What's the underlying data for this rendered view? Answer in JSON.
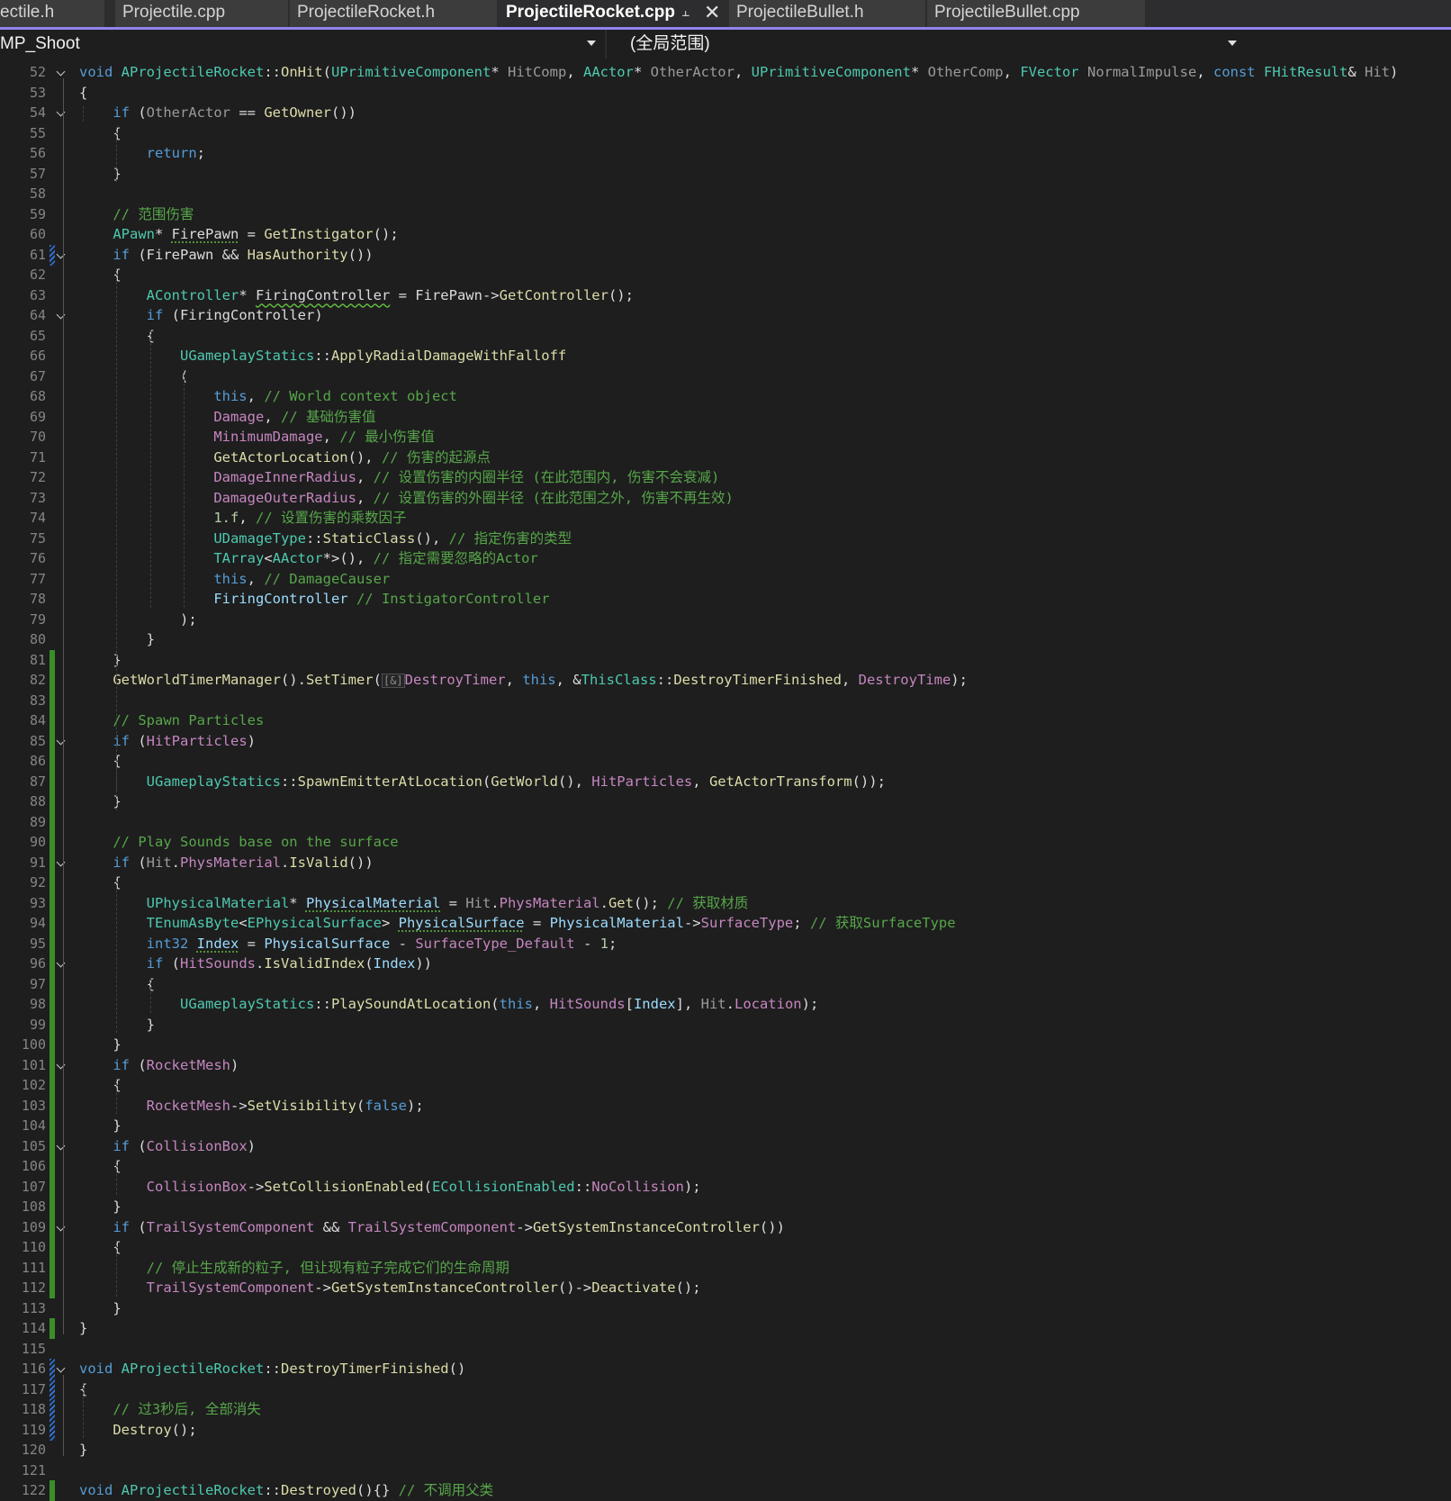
{
  "tabs": [
    {
      "label": "ectile.h",
      "active": false
    },
    {
      "label": "Projectile.cpp",
      "active": false
    },
    {
      "label": "ProjectileRocket.h",
      "active": false
    },
    {
      "label": "ProjectileRocket.cpp",
      "active": true,
      "pin_icon": "pin-icon",
      "close_icon": "close-icon"
    },
    {
      "label": "ProjectileBullet.h",
      "active": false
    },
    {
      "label": "ProjectileBullet.cpp",
      "active": false
    }
  ],
  "nav": {
    "project": "MP_Shoot",
    "scope": "(全局范围)"
  },
  "colors": {
    "accent": "#9184ee",
    "keyword": "#569cd6",
    "type": "#4ec9b0",
    "function": "#dcdcaa",
    "comment": "#57a64a",
    "member": "#c586c0",
    "change_saved": "#3a8e2a",
    "change_unsaved": "#2f6fd1"
  },
  "code": {
    "lines": [
      {
        "n": "52",
        "bar": "",
        "fold": true,
        "html": "<span class='k'>void</span> <span class='t'>AProjectileRocket</span>::<span class='f'>OnHit</span>(<span class='t'>UPrimitiveComponent</span>* <span class='v'>HitComp</span>, <span class='t'>AActor</span>* <span class='v'>OtherActor</span>, <span class='t'>UPrimitiveComponent</span>* <span class='v'>OtherComp</span>, <span class='t'>FVector</span> <span class='v'>NormalImpulse</span>, <span class='k'>const</span> <span class='t'>FHitResult</span>&amp; <span class='v'>Hit</span>)"
      },
      {
        "n": "53",
        "bar": "",
        "fold": false,
        "html": "{"
      },
      {
        "n": "54",
        "bar": "",
        "fold": true,
        "html": "    <span class='k'>if</span> (<span class='v'>OtherActor</span> == <span class='f'>GetOwner</span>())"
      },
      {
        "n": "55",
        "bar": "",
        "fold": false,
        "html": "    {"
      },
      {
        "n": "56",
        "bar": "",
        "fold": false,
        "html": "        <span class='k'>return</span>;"
      },
      {
        "n": "57",
        "bar": "",
        "fold": false,
        "html": "    }"
      },
      {
        "n": "58",
        "bar": "",
        "fold": false,
        "html": ""
      },
      {
        "n": "59",
        "bar": "",
        "fold": false,
        "html": "    <span class='c'>// 范围伤害</span>"
      },
      {
        "n": "60",
        "bar": "",
        "fold": false,
        "html": "    <span class='t'>APawn</span>* <span class='dots'>FirePawn</span> = <span class='f'>GetInstigator</span>();"
      },
      {
        "n": "61",
        "bar": "unsaved",
        "fold": true,
        "html": "    <span class='k'>if</span> (<span class='v2'>FirePawn</span> &amp;&amp; <span class='f'>HasAuthority</span>())"
      },
      {
        "n": "62",
        "bar": "",
        "fold": false,
        "html": "    {"
      },
      {
        "n": "63",
        "bar": "",
        "fold": false,
        "html": "        <span class='t'>AController</span>* <span class='squig'>FiringController</span> = <span class='v2'>FirePawn</span>-><span class='f'>GetController</span>();"
      },
      {
        "n": "64",
        "bar": "",
        "fold": true,
        "html": "        <span class='k'>if</span> (<span class='v2'>FiringController</span>)"
      },
      {
        "n": "65",
        "bar": "",
        "fold": false,
        "html": "        {"
      },
      {
        "n": "66",
        "bar": "",
        "fold": false,
        "html": "            <span class='t'>UGameplayStatics</span>::<span class='f'>ApplyRadialDamageWithFalloff</span>"
      },
      {
        "n": "67",
        "bar": "",
        "fold": false,
        "html": "            ("
      },
      {
        "n": "68",
        "bar": "",
        "fold": false,
        "html": "                <span class='k'>this</span>, <span class='c'>// World context object</span>"
      },
      {
        "n": "69",
        "bar": "",
        "fold": false,
        "html": "                <span class='m'>Damage</span>, <span class='c'>// 基础伤害值</span>"
      },
      {
        "n": "70",
        "bar": "",
        "fold": false,
        "html": "                <span class='m'>MinimumDamage</span>, <span class='c'>// 最小伤害值</span>"
      },
      {
        "n": "71",
        "bar": "",
        "fold": false,
        "html": "                <span class='f'>GetActorLocation</span>(), <span class='c'>// 伤害的起源点</span>"
      },
      {
        "n": "72",
        "bar": "",
        "fold": false,
        "html": "                <span class='m'>DamageInnerRadius</span>, <span class='c'>// 设置伤害的内圈半径 (在此范围内, 伤害不会衰减)</span>"
      },
      {
        "n": "73",
        "bar": "",
        "fold": false,
        "html": "                <span class='m'>DamageOuterRadius</span>, <span class='c'>// 设置伤害的外圈半径 (在此范围之外, 伤害不再生效)</span>"
      },
      {
        "n": "74",
        "bar": "",
        "fold": false,
        "html": "                <span class='n'>1.f</span>, <span class='c'>// 设置伤害的乘数因子</span>"
      },
      {
        "n": "75",
        "bar": "",
        "fold": false,
        "html": "                <span class='t'>UDamageType</span>::<span class='f'>StaticClass</span>(), <span class='c'>// 指定伤害的类型</span>"
      },
      {
        "n": "76",
        "bar": "",
        "fold": false,
        "html": "                <span class='t'>TArray</span>&lt;<span class='t'>AActor</span>*&gt;(), <span class='c'>// 指定需要忽略的Actor</span>"
      },
      {
        "n": "77",
        "bar": "",
        "fold": false,
        "html": "                <span class='k'>this</span>, <span class='c'>// DamageCauser</span>"
      },
      {
        "n": "78",
        "bar": "",
        "fold": false,
        "html": "                <span class='p'>FiringController</span> <span class='c'>// InstigatorController</span>"
      },
      {
        "n": "79",
        "bar": "",
        "fold": false,
        "html": "            );"
      },
      {
        "n": "80",
        "bar": "",
        "fold": false,
        "html": "        }"
      },
      {
        "n": "81",
        "bar": "saved",
        "fold": false,
        "html": "    }"
      },
      {
        "n": "82",
        "bar": "saved",
        "fold": false,
        "html": "    <span class='f'>GetWorldTimerManager</span>().<span class='f'>SetTimer</span>(<span class='hint'>[&amp;]</span><span class='m'>DestroyTimer</span>, <span class='k'>this</span>, &amp;<span class='t'>ThisClass</span>::<span class='f'>DestroyTimerFinished</span>, <span class='m'>DestroyTime</span>);"
      },
      {
        "n": "83",
        "bar": "saved",
        "fold": false,
        "html": ""
      },
      {
        "n": "84",
        "bar": "saved",
        "fold": false,
        "html": "    <span class='c'>// Spawn Particles</span>"
      },
      {
        "n": "85",
        "bar": "saved",
        "fold": true,
        "html": "    <span class='k'>if</span> (<span class='m'>HitParticles</span>)"
      },
      {
        "n": "86",
        "bar": "saved",
        "fold": false,
        "html": "    {"
      },
      {
        "n": "87",
        "bar": "saved",
        "fold": false,
        "html": "        <span class='t'>UGameplayStatics</span>::<span class='f'>SpawnEmitterAtLocation</span>(<span class='f'>GetWorld</span>(), <span class='m'>HitParticles</span>, <span class='f'>GetActorTransform</span>());"
      },
      {
        "n": "88",
        "bar": "saved",
        "fold": false,
        "html": "    }"
      },
      {
        "n": "89",
        "bar": "saved",
        "fold": false,
        "html": ""
      },
      {
        "n": "90",
        "bar": "saved",
        "fold": false,
        "html": "    <span class='c'>// Play Sounds base on the surface</span>"
      },
      {
        "n": "91",
        "bar": "saved",
        "fold": true,
        "html": "    <span class='k'>if</span> (<span class='v'>Hit</span>.<span class='m'>PhysMaterial</span>.<span class='f'>IsValid</span>())"
      },
      {
        "n": "92",
        "bar": "saved",
        "fold": false,
        "html": "    {"
      },
      {
        "n": "93",
        "bar": "saved",
        "fold": false,
        "html": "        <span class='t'>UPhysicalMaterial</span>* <span class='dots p'>PhysicalMaterial</span> = <span class='v'>Hit</span>.<span class='m'>PhysMaterial</span>.<span class='f'>Get</span>(); <span class='c'>// 获取材质</span>"
      },
      {
        "n": "94",
        "bar": "saved",
        "fold": false,
        "html": "        <span class='t'>TEnumAsByte</span>&lt;<span class='t'>EPhysicalSurface</span>&gt; <span class='dots p'>PhysicalSurface</span> = <span class='p'>PhysicalMaterial</span>-><span class='m'>SurfaceType</span>; <span class='c'>// 获取SurfaceType</span>"
      },
      {
        "n": "95",
        "bar": "saved",
        "fold": false,
        "html": "        <span class='k'>int32</span> <span class='dots p'>Index</span> = <span class='p'>PhysicalSurface</span> - <span class='m'>SurfaceType_Default</span> - <span class='n'>1</span>;"
      },
      {
        "n": "96",
        "bar": "saved",
        "fold": true,
        "html": "        <span class='k'>if</span> (<span class='m'>HitSounds</span>.<span class='f'>IsValidIndex</span>(<span class='p'>Index</span>))"
      },
      {
        "n": "97",
        "bar": "saved",
        "fold": false,
        "html": "        {"
      },
      {
        "n": "98",
        "bar": "saved",
        "fold": false,
        "html": "            <span class='t'>UGameplayStatics</span>::<span class='f'>PlaySoundAtLocation</span>(<span class='k'>this</span>, <span class='m'>HitSounds</span>[<span class='p'>Index</span>], <span class='v'>Hit</span>.<span class='m'>Location</span>);"
      },
      {
        "n": "99",
        "bar": "saved",
        "fold": false,
        "html": "        }"
      },
      {
        "n": "100",
        "bar": "saved",
        "fold": false,
        "html": "    }"
      },
      {
        "n": "101",
        "bar": "saved",
        "fold": true,
        "html": "    <span class='k'>if</span> (<span class='m'>RocketMesh</span>)"
      },
      {
        "n": "102",
        "bar": "saved",
        "fold": false,
        "html": "    {"
      },
      {
        "n": "103",
        "bar": "saved",
        "fold": false,
        "html": "        <span class='m'>RocketMesh</span>-><span class='f'>SetVisibility</span>(<span class='k'>false</span>);"
      },
      {
        "n": "104",
        "bar": "saved",
        "fold": false,
        "html": "    }"
      },
      {
        "n": "105",
        "bar": "saved",
        "fold": true,
        "html": "    <span class='k'>if</span> (<span class='m'>CollisionBox</span>)"
      },
      {
        "n": "106",
        "bar": "saved",
        "fold": false,
        "html": "    {"
      },
      {
        "n": "107",
        "bar": "saved",
        "fold": false,
        "html": "        <span class='m'>CollisionBox</span>-><span class='f'>SetCollisionEnabled</span>(<span class='t'>ECollisionEnabled</span>::<span class='m'>NoCollision</span>);"
      },
      {
        "n": "108",
        "bar": "saved",
        "fold": false,
        "html": "    }"
      },
      {
        "n": "109",
        "bar": "saved",
        "fold": true,
        "html": "    <span class='k'>if</span> (<span class='m'>TrailSystemComponent</span> &amp;&amp; <span class='m'>TrailSystemComponent</span>-><span class='f'>GetSystemInstanceController</span>())"
      },
      {
        "n": "110",
        "bar": "saved",
        "fold": false,
        "html": "    {"
      },
      {
        "n": "111",
        "bar": "saved",
        "fold": false,
        "html": "        <span class='c'>// 停止生成新的粒子, 但让现有粒子完成它们的生命周期</span>"
      },
      {
        "n": "112",
        "bar": "saved",
        "fold": false,
        "html": "        <span class='m'>TrailSystemComponent</span>-><span class='f'>GetSystemInstanceController</span>()-><span class='f'>Deactivate</span>();"
      },
      {
        "n": "113",
        "bar": "",
        "fold": false,
        "html": "    }"
      },
      {
        "n": "114",
        "bar": "saved",
        "fold": false,
        "html": "}"
      },
      {
        "n": "115",
        "bar": "",
        "fold": false,
        "html": ""
      },
      {
        "n": "116",
        "bar": "unsaved",
        "fold": true,
        "html": "<span class='k'>void</span> <span class='t'>AProjectileRocket</span>::<span class='f'>DestroyTimerFinished</span>()"
      },
      {
        "n": "117",
        "bar": "unsaved",
        "fold": false,
        "html": "{"
      },
      {
        "n": "118",
        "bar": "unsaved",
        "fold": false,
        "html": "    <span class='c'>// 过3秒后, 全部消失</span>"
      },
      {
        "n": "119",
        "bar": "unsaved",
        "fold": false,
        "html": "    <span class='f'>Destroy</span>();"
      },
      {
        "n": "120",
        "bar": "",
        "fold": false,
        "html": "}"
      },
      {
        "n": "121",
        "bar": "",
        "fold": false,
        "html": ""
      },
      {
        "n": "122",
        "bar": "saved",
        "fold": false,
        "html": "<span class='k'>void</span> <span class='t'>AProjectileRocket</span>::<span class='f'>Destroyed</span>(){} <span class='c'>// 不调用父类</span>"
      }
    ]
  }
}
